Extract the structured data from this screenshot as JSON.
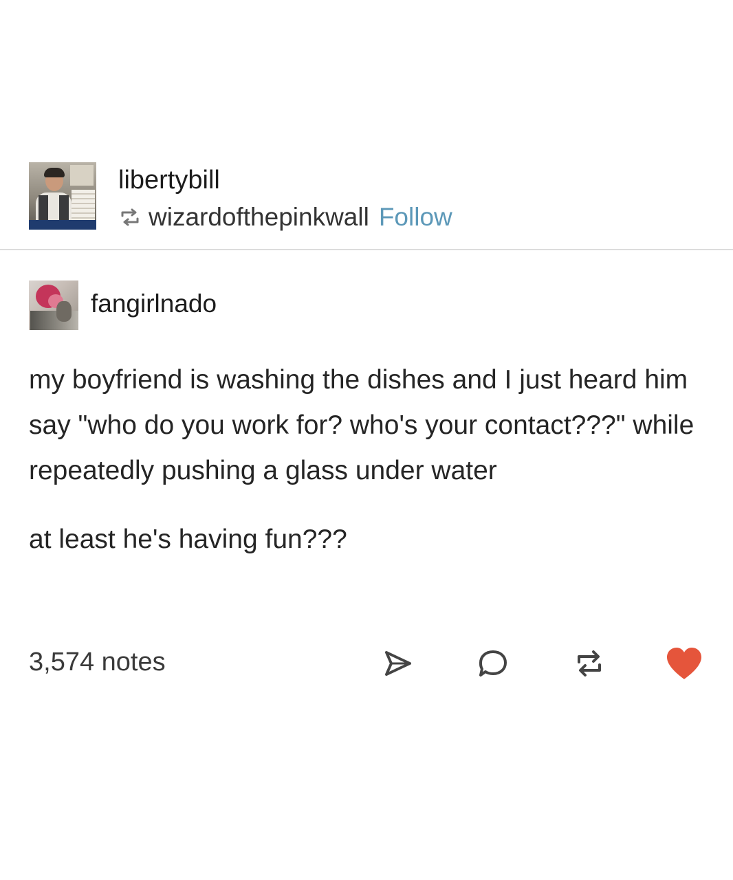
{
  "header": {
    "username": "libertybill",
    "reblogged_from": "wizardofthepinkwall",
    "follow_label": "Follow",
    "accent_color": "#5c98b8"
  },
  "original_post": {
    "username": "fangirlnado",
    "paragraphs": [
      "my boyfriend is washing the dishes and I just heard him say \"who do you work for? who's your contact???\" while repeatedly pushing a glass under water",
      "at least he's having fun???"
    ]
  },
  "footer": {
    "notes": "3,574 notes",
    "icons": [
      "share-icon",
      "reply-icon",
      "reblog-icon",
      "heart-icon"
    ],
    "heart_color": "#e5553b"
  }
}
